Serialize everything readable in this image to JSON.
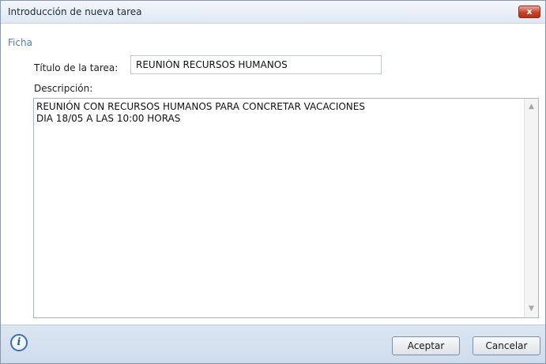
{
  "window": {
    "title": "Introducción de nueva tarea",
    "close_label": "x"
  },
  "tab": {
    "label": "Ficha"
  },
  "form": {
    "title_label": "Título de la tarea:",
    "title_value": "REUNIÓN RECURSOS HUMANOS",
    "description_label": "Descripción:",
    "description_value": "REUNIÓN CON RECURSOS HUMANOS PARA CONCRETAR VACACIONES\nDIA 18/05 A LAS 10:00 HORAS"
  },
  "scrollbar": {
    "up_icon": "arrow-up-icon",
    "down_icon": "arrow-down-icon",
    "up_glyph": "▲",
    "down_glyph": "▼"
  },
  "footer": {
    "info_icon": "info-icon",
    "info_glyph": "i",
    "accept_label": "Aceptar",
    "cancel_label": "Cancelar"
  },
  "colors": {
    "accent": "#4a7fc0",
    "close": "#c7422b",
    "footer_bg": "#d6e2ef"
  }
}
